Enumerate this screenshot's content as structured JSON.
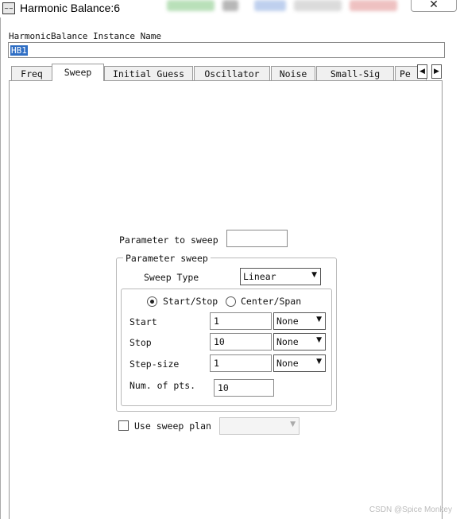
{
  "window": {
    "title": "Harmonic Balance:6",
    "icon_name": "app-icon",
    "close_glyph": "✕"
  },
  "instance": {
    "label": "HarmonicBalance Instance Name",
    "value": "HB1"
  },
  "tabs": [
    {
      "label": "Freq",
      "active": false
    },
    {
      "label": "Sweep",
      "active": true
    },
    {
      "label": "Initial Guess",
      "active": false
    },
    {
      "label": "Oscillator",
      "active": false
    },
    {
      "label": "Noise",
      "active": false
    },
    {
      "label": "Small-Sig",
      "active": false
    },
    {
      "label": "Pe",
      "active": false
    }
  ],
  "tab_scroll": {
    "left": "◀",
    "right": "▶"
  },
  "sweep": {
    "param_label": "Parameter to sweep",
    "param_value": "",
    "group_title": "Parameter sweep",
    "sweep_type_label": "Sweep Type",
    "sweep_type_value": "Linear",
    "mode_options": [
      {
        "label": "Start/Stop",
        "selected": true
      },
      {
        "label": "Center/Span",
        "selected": false
      }
    ],
    "rows": [
      {
        "label": "Start",
        "value": "1",
        "unit": "None"
      },
      {
        "label": "Stop",
        "value": "10",
        "unit": "None"
      },
      {
        "label": "Step-size",
        "value": "1",
        "unit": "None"
      }
    ],
    "num_pts_label": "Num. of pts.",
    "num_pts_value": "10",
    "use_plan_label": "Use sweep plan",
    "use_plan_checked": false,
    "plan_value": ""
  },
  "dropdown_arrow": "▼",
  "watermark": "CSDN @Spice Monkey"
}
